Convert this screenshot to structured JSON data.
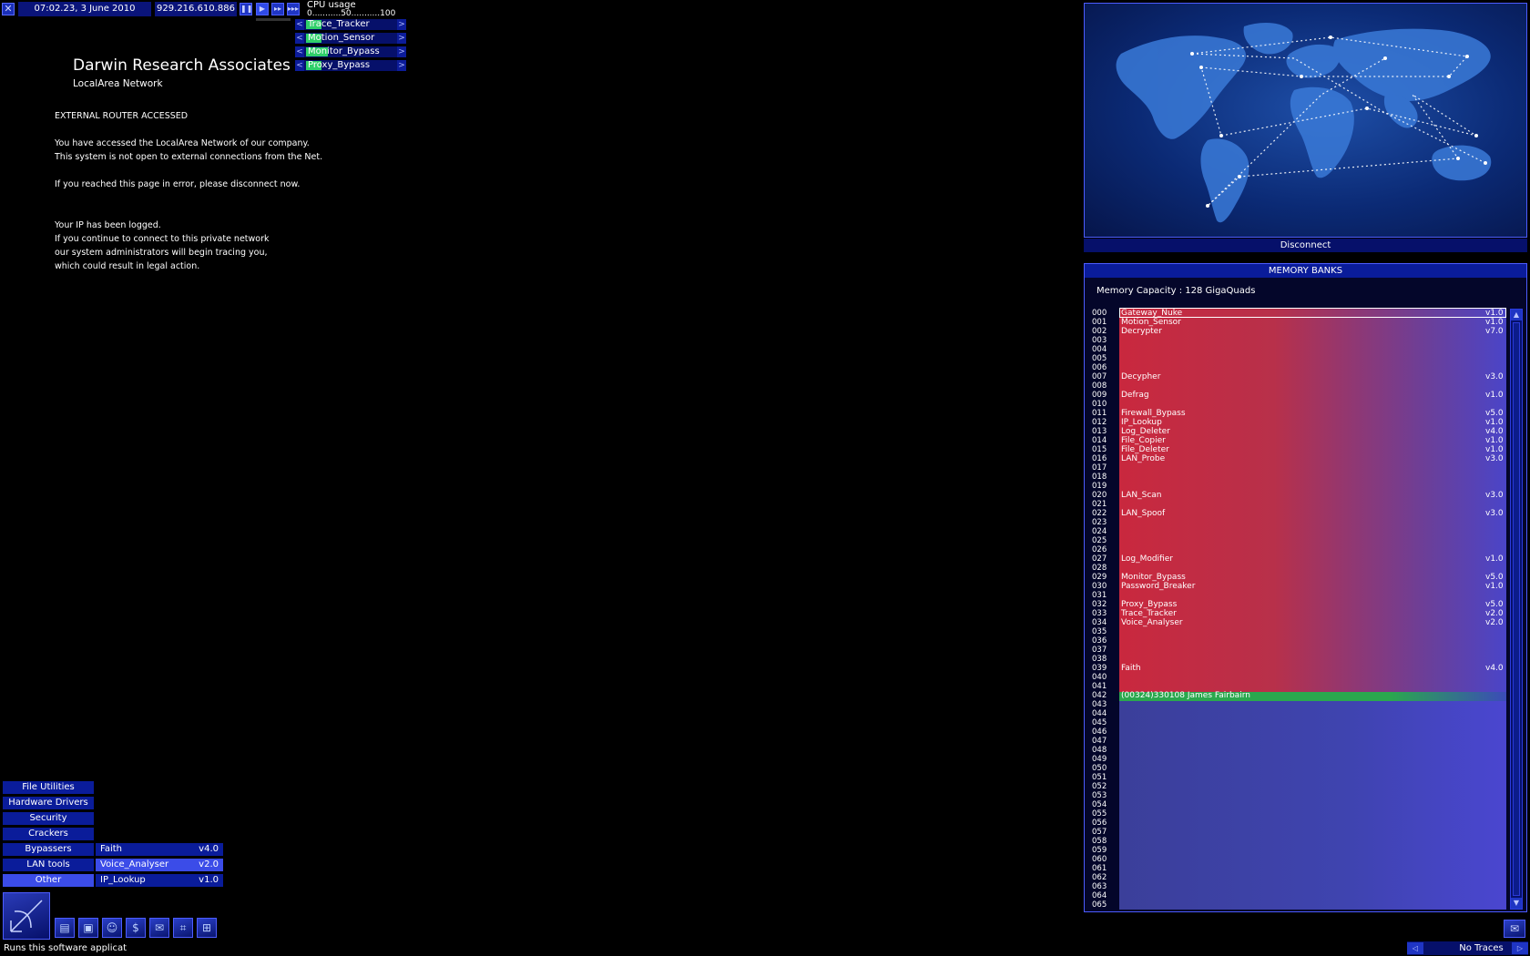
{
  "topbar": {
    "clock": "07:02.23, 3 June 2010",
    "ip": "929.216.610.886",
    "close_icon": "close-icon"
  },
  "cpu": {
    "title": "CPU usage",
    "scale": "0...........50...........100",
    "rows": [
      {
        "label": "Trace_Tracker",
        "level": 0.17
      },
      {
        "label": "Motion_Sensor",
        "level": 0.17
      },
      {
        "label": "Monitor_Bypass",
        "level": 0.24
      },
      {
        "label": "Proxy_Bypass",
        "level": 0.17
      }
    ]
  },
  "site": {
    "company": "Darwin Research Associates",
    "subtitle": "LocalArea Network",
    "line1": "EXTERNAL ROUTER ACCESSED",
    "line2": "You have accessed the LocalArea Network of our company.",
    "line3": "This system is not open to external connections from the Net.",
    "line4": "If you reached this page in error, please disconnect now.",
    "line5": "Your IP has been logged.",
    "line6": "If you continue to connect to this private network",
    "line7": "our system administrators will begin tracing you,",
    "line8": "which could result in legal action."
  },
  "map": {
    "disconnect": "Disconnect"
  },
  "memory": {
    "title": "MEMORY BANKS",
    "capacity": "Memory Capacity : 128 GigaQuads",
    "slots": [
      {
        "n": "000",
        "name": "Gateway_Nuke",
        "ver": "v1.0"
      },
      {
        "n": "001",
        "name": "Motion_Sensor",
        "ver": "v1.0"
      },
      {
        "n": "002",
        "name": "Decrypter",
        "ver": "v7.0"
      },
      {
        "n": "007",
        "name": "Decypher",
        "ver": "v3.0"
      },
      {
        "n": "009",
        "name": "Defrag",
        "ver": "v1.0"
      },
      {
        "n": "011",
        "name": "Firewall_Bypass",
        "ver": "v5.0"
      },
      {
        "n": "012",
        "name": "IP_Lookup",
        "ver": "v1.0"
      },
      {
        "n": "013",
        "name": "Log_Deleter",
        "ver": "v4.0"
      },
      {
        "n": "014",
        "name": "File_Copier",
        "ver": "v1.0"
      },
      {
        "n": "015",
        "name": "File_Deleter",
        "ver": "v1.0"
      },
      {
        "n": "016",
        "name": "LAN_Probe",
        "ver": "v3.0"
      },
      {
        "n": "020",
        "name": "LAN_Scan",
        "ver": "v3.0"
      },
      {
        "n": "022",
        "name": "LAN_Spoof",
        "ver": "v3.0"
      },
      {
        "n": "027",
        "name": "Log_Modifier",
        "ver": "v1.0"
      },
      {
        "n": "029",
        "name": "Monitor_Bypass",
        "ver": "v5.0"
      },
      {
        "n": "030",
        "name": "Password_Breaker",
        "ver": "v1.0"
      },
      {
        "n": "032",
        "name": "Proxy_Bypass",
        "ver": "v5.0"
      },
      {
        "n": "033",
        "name": "Trace_Tracker",
        "ver": "v2.0"
      },
      {
        "n": "034",
        "name": "Voice_Analyser",
        "ver": "v2.0"
      },
      {
        "n": "039",
        "name": "Faith",
        "ver": "v4.0"
      },
      {
        "n": "042",
        "name": "(00324)330108 James Fairbairn",
        "ver": ""
      }
    ],
    "numbers": [
      "000",
      "001",
      "002",
      "003",
      "004",
      "005",
      "006",
      "007",
      "008",
      "009",
      "010",
      "011",
      "012",
      "013",
      "014",
      "015",
      "016",
      "017",
      "018",
      "019",
      "020",
      "021",
      "022",
      "023",
      "024",
      "025",
      "026",
      "027",
      "028",
      "029",
      "030",
      "031",
      "032",
      "033",
      "034",
      "035",
      "036",
      "037",
      "038",
      "039",
      "040",
      "041",
      "042",
      "043",
      "044",
      "045",
      "046",
      "047",
      "048",
      "049",
      "050",
      "051",
      "052",
      "053",
      "054",
      "055",
      "056",
      "057",
      "058",
      "059",
      "060",
      "061",
      "062",
      "063",
      "064",
      "065"
    ]
  },
  "menu": {
    "categories": [
      "File Utilities",
      "Hardware Drivers",
      "Security",
      "Crackers",
      "Bypassers",
      "LAN tools",
      "Other"
    ],
    "sub_items": [
      {
        "name": "Faith",
        "ver": "v4.0"
      },
      {
        "name": "Voice_Analyser",
        "ver": "v2.0"
      },
      {
        "name": "IP_Lookup",
        "ver": "v1.0"
      }
    ]
  },
  "status": "Runs this software applicat",
  "trace": "No Traces",
  "colors": {
    "accent": "#0a1c9a",
    "highlight": "#3b4ce8",
    "green": "#2fd06a"
  }
}
